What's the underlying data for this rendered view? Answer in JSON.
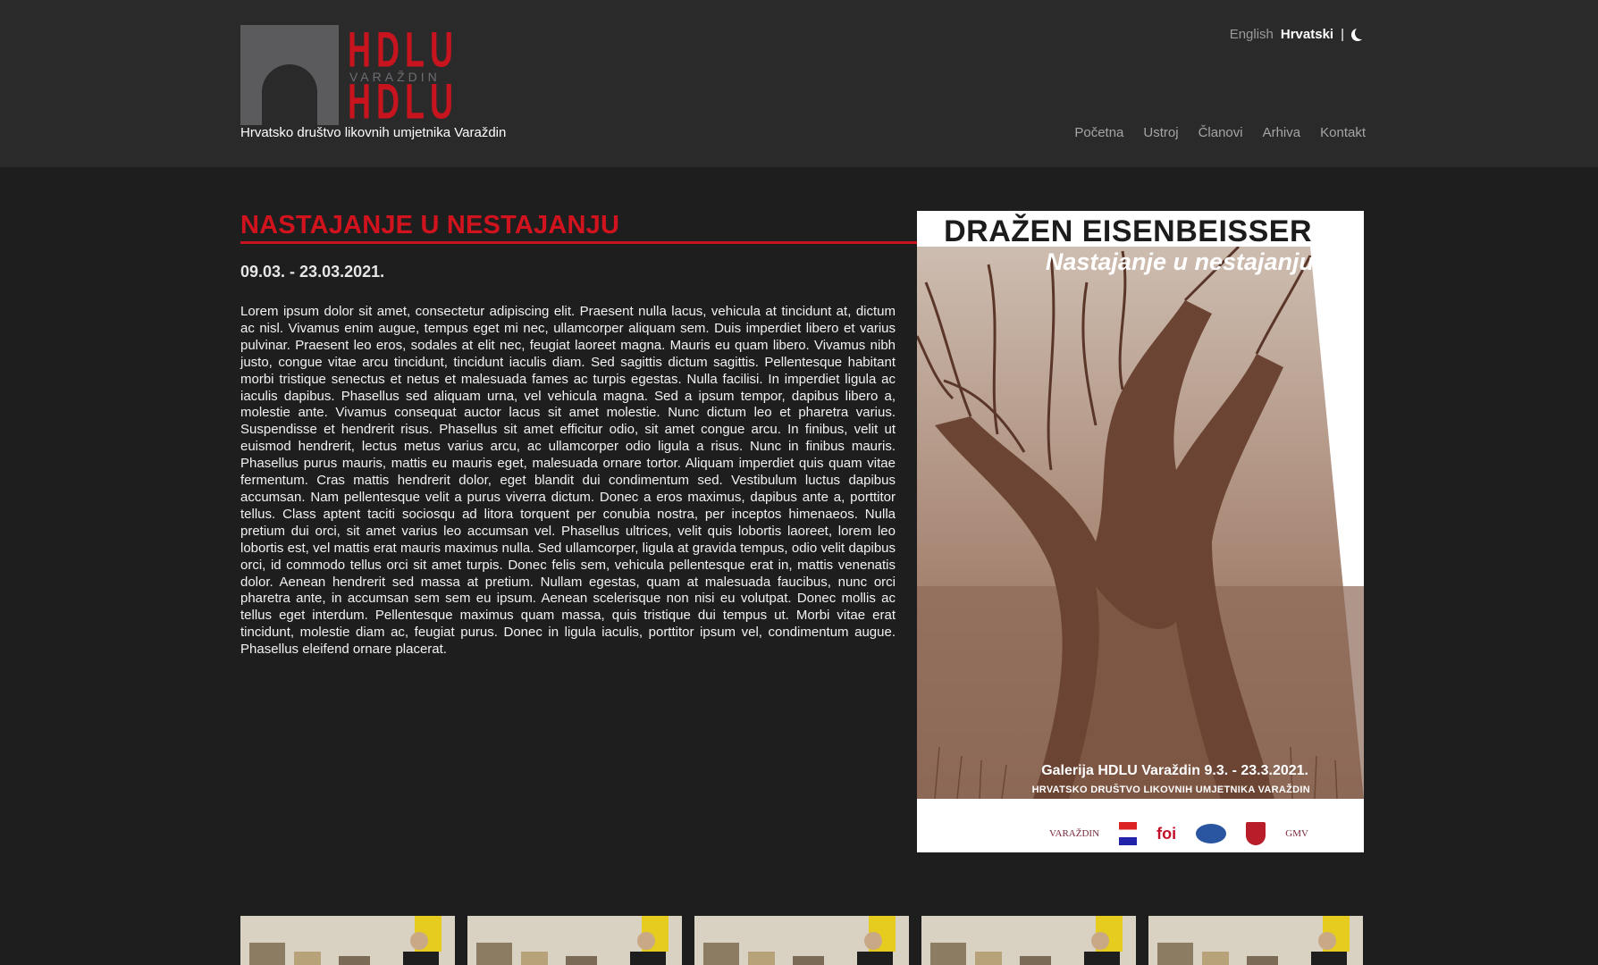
{
  "header": {
    "logo_letters_top": "HDLU",
    "logo_letters_bottom": "HDLU",
    "logo_town": "VARAŽDIN",
    "tagline": "Hrvatsko društvo likovnih umjetnika Varaždin",
    "languages": [
      {
        "label": "English",
        "active": false
      },
      {
        "label": "Hrvatski",
        "active": true
      }
    ],
    "separator": "|",
    "theme_icon": "moon-icon",
    "nav": [
      "Početna",
      "Ustroj",
      "Članovi",
      "Arhiva",
      "Kontakt"
    ]
  },
  "event": {
    "title": "NASTAJANJE U NESTAJANJU",
    "dates": "09.03. - 23.03.2021.",
    "body": "Lorem ipsum dolor sit amet, consectetur adipiscing elit. Praesent nulla lacus, vehicula at tincidunt at, dictum ac nisl. Vivamus enim augue, tempus eget mi nec, ullamcorper aliquam sem. Duis imperdiet libero et varius pulvinar. Praesent leo eros, sodales at elit nec, feugiat laoreet magna. Mauris eu quam libero. Vivamus nibh justo, congue vitae arcu tincidunt, tincidunt iaculis diam. Sed sagittis dictum sagittis. Pellentesque habitant morbi tristique senectus et netus et malesuada fames ac turpis egestas. Nulla facilisi. In imperdiet ligula ac iaculis dapibus. Phasellus sed aliquam urna, vel vehicula magna. Sed a ipsum tempor, dapibus libero a, molestie ante. Vivamus consequat auctor lacus sit amet molestie. Nunc dictum leo et pharetra varius. Suspendisse et hendrerit risus. Phasellus sit amet efficitur odio, sit amet congue arcu. In finibus, velit ut euismod hendrerit, lectus metus varius arcu, ac ullamcorper odio ligula a risus. Nunc in finibus mauris. Phasellus purus mauris, mattis eu mauris eget, malesuada ornare tortor. Aliquam imperdiet quis quam vitae fermentum. Cras mattis hendrerit dolor, eget blandit dui condimentum sed. Vestibulum luctus dapibus accumsan. Nam pellentesque velit a purus viverra dictum. Donec a eros maximus, dapibus ante a, porttitor tellus. Class aptent taciti sociosqu ad litora torquent per conubia nostra, per inceptos himenaeos. Nulla pretium dui orci, sit amet varius leo accumsan vel. Phasellus ultrices, velit quis lobortis laoreet, lorem leo lobortis est, vel mattis erat mauris maximus nulla. Sed ullamcorper, ligula at gravida tempus, odio velit dapibus orci, id commodo tellus orci sit amet turpis. Donec felis sem, vehicula pellentesque erat in, mattis venenatis dolor. Aenean hendrerit sed massa at pretium. Nullam egestas, quam at malesuada faucibus, nunc orci pharetra ante, in accumsan sem sem eu ipsum. Aenean scelerisque non nisi eu volutpat. Donec mollis ac tellus eget interdum. Pellentesque maximus quam massa, quis tristique dui tempus ut. Morbi vitae erat tincidunt, molestie diam ac, feugiat purus. Donec in ligula iaculis, porttitor ipsum vel, condimentum augue. Phasellus eleifend ornare placerat."
  },
  "poster": {
    "artist": "DRAŽEN EISENBEISSER",
    "subtitle": "Nastajanje u nestajanju",
    "gallery_line": "Galerija HDLU Varaždin 9.3. - 23.3.2021.",
    "organization": "HRVATSKO DRUŠTVO LIKOVNIH UMJETNIKA VARAŽDIN",
    "sponsors": [
      {
        "type": "text",
        "label": "VARAŽDIN"
      },
      {
        "type": "icon",
        "label": "flag-icon"
      },
      {
        "type": "text",
        "label": "foi"
      },
      {
        "type": "icon",
        "label": "oval-logo-icon"
      },
      {
        "type": "icon",
        "label": "coat-of-arms-icon"
      },
      {
        "type": "text",
        "label": "GMV"
      }
    ]
  },
  "gallery_thumbnails": 5,
  "colors": {
    "accent": "#c8141e",
    "background": "#1e1e1f",
    "header_bg": "#2a2a2b",
    "logo_gray": "#5b5b5e"
  }
}
